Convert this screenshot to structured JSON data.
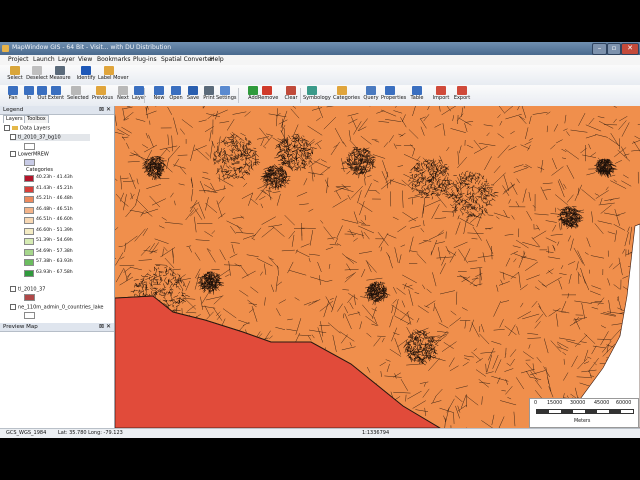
{
  "window": {
    "title": "MapWindow GIS - 64 Bit - Visit... with DU Distribution"
  },
  "menu": [
    "Project",
    "Launch",
    "Layer",
    "View",
    "Bookmarks",
    "Plug-ins",
    "Spatial Converter",
    "Help"
  ],
  "toolbar1": [
    {
      "label": "Select",
      "icon": "select-icon",
      "color": "#d9a63a"
    },
    {
      "label": "Deselect",
      "icon": "deselect-icon",
      "color": "#bfbfbf"
    },
    {
      "label": "Measure",
      "icon": "measure-icon",
      "color": "#5a6a7a"
    },
    {
      "label": "Identify",
      "icon": "identify-icon",
      "color": "#1e58b8"
    },
    {
      "label": "Label Mover",
      "icon": "label-mover-icon",
      "color": "#e0a53c"
    }
  ],
  "toolbar2": [
    {
      "label": "Pan",
      "icon": "pan-icon",
      "color": "#3a6fc0"
    },
    {
      "label": "In",
      "icon": "zoom-in-icon",
      "color": "#3a6fc0"
    },
    {
      "label": "Out",
      "icon": "zoom-out-icon",
      "color": "#3a6fc0"
    },
    {
      "label": "Extent",
      "icon": "extent-icon",
      "color": "#3a6fc0"
    },
    {
      "label": "Selected",
      "icon": "zoom-selected-icon",
      "color": "#b8b8b8"
    },
    {
      "label": "Previous",
      "icon": "previous-icon",
      "color": "#e0a53c"
    },
    {
      "label": "Next",
      "icon": "next-icon",
      "color": "#b8b8b8"
    },
    {
      "label": "Layer",
      "icon": "zoom-layer-icon",
      "color": "#3a6fc0"
    },
    {
      "label": "New",
      "icon": "new-icon",
      "color": "#3a6fc0"
    },
    {
      "label": "Open",
      "icon": "open-icon",
      "color": "#3a6fc0"
    },
    {
      "label": "Save",
      "icon": "save-icon",
      "color": "#2a5fb0"
    },
    {
      "label": "Print",
      "icon": "print-icon",
      "color": "#5a6a7a"
    },
    {
      "label": "Settings",
      "icon": "settings-icon",
      "color": "#5a8ad0"
    },
    {
      "label": "Add",
      "icon": "add-layer-icon",
      "color": "#2f9a3c"
    },
    {
      "label": "Remove",
      "icon": "remove-layer-icon",
      "color": "#d03a2a"
    },
    {
      "label": "Clear",
      "icon": "clear-icon",
      "color": "#c04a3a"
    },
    {
      "label": "Symbology",
      "icon": "symbology-icon",
      "color": "#3a9a8a"
    },
    {
      "label": "Categories",
      "icon": "categories-icon",
      "color": "#e0a53c"
    },
    {
      "label": "Query",
      "icon": "query-icon",
      "color": "#4a7ac0"
    },
    {
      "label": "Properties",
      "icon": "properties-icon",
      "color": "#3a6fc0"
    },
    {
      "label": "Table",
      "icon": "table-icon",
      "color": "#3a6fc0"
    },
    {
      "label": "Import",
      "icon": "import-icon",
      "color": "#d04a3a"
    },
    {
      "label": "Export",
      "icon": "export-icon",
      "color": "#d04a3a"
    }
  ],
  "legend_panel": {
    "title": "Legend",
    "tabs": [
      "Layers",
      "Toolbox"
    ],
    "group": "Data Layers",
    "layers": [
      {
        "name": "tl_2010_37_bg10",
        "color": "#ffffff"
      },
      {
        "name": "LowerMREW",
        "color": "#c8cbe6"
      },
      {
        "name": "tl_2010_37",
        "color": "#b04848"
      },
      {
        "name": "ne_110m_admin_0_countries_lake",
        "color": "#ffffff"
      }
    ],
    "categories_label": "Categories",
    "categories": [
      {
        "label": "40.23h - 41.43h",
        "color": "#b4142a"
      },
      {
        "label": "41.43h - 45.21h",
        "color": "#d8403a"
      },
      {
        "label": "45.21h - 46.48h",
        "color": "#ec8a5e"
      },
      {
        "label": "46.48h - 46.51h",
        "color": "#f3b48a"
      },
      {
        "label": "46.51h - 46.60h",
        "color": "#f7d8b4"
      },
      {
        "label": "46.60h - 51.39h",
        "color": "#f4ecc4"
      },
      {
        "label": "51.39h - 54.69h",
        "color": "#d6ecb4"
      },
      {
        "label": "54.69h - 57.38h",
        "color": "#a6d68c"
      },
      {
        "label": "57.38h - 63.93h",
        "color": "#6bbd5f"
      },
      {
        "label": "63.93h - 67.58h",
        "color": "#2f9a3c"
      }
    ]
  },
  "preview_panel": {
    "title": "Preview Map"
  },
  "status": {
    "projection": "GCS_WGS_1984",
    "coords": "Lat: 35.780 Long: -79.123",
    "scale": "1:1336794"
  },
  "scalebar": {
    "ticks": [
      "0",
      "15000",
      "30000",
      "45000",
      "60000"
    ],
    "unit": "Meters"
  },
  "map": {
    "fill": "#f08f4c",
    "state_fill": "#e14b3a",
    "ocean": "#ffffff"
  }
}
